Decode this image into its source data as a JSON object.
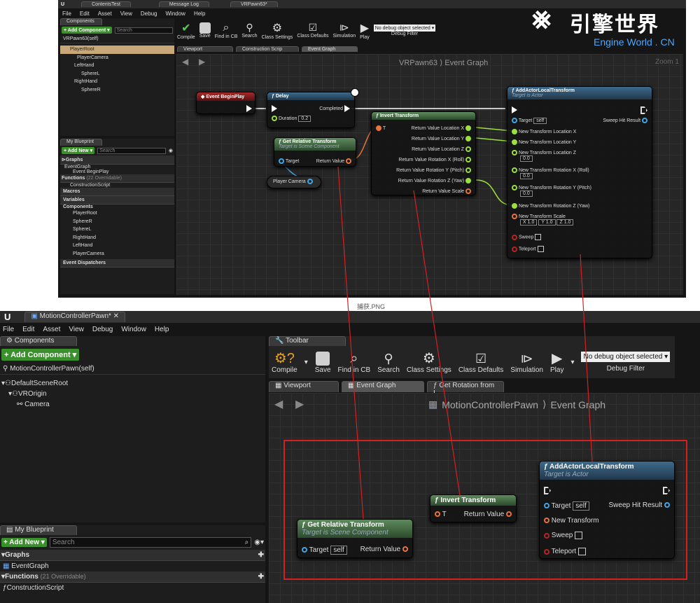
{
  "top": {
    "tabs": [
      "ContentsTest",
      "Message Log",
      "VRPawn63*"
    ],
    "menu": [
      "File",
      "Edit",
      "Asset",
      "View",
      "Debug",
      "Window",
      "Help"
    ],
    "components_tab": "Components",
    "add_component": "+ Add Component ▾",
    "search_placeholder": "Search",
    "self_label": "VRPawn63(self)",
    "tree": [
      "PlayerRoot",
      "PlayerCamera",
      "LeftHand",
      "SphereL",
      "RightHand",
      "SphereR"
    ],
    "my_blueprint_tab": "My Blueprint",
    "add_new": "+ Add New ▾",
    "graphs_header": "Graphs",
    "graph_items": [
      "EventGraph",
      "Event BeginPlay"
    ],
    "functions_header": "Functions",
    "functions_count": "(22 Overridable)",
    "function_items": [
      "ConstructionScript"
    ],
    "macros_header": "Macros",
    "variables_header": "Variables",
    "components_header": "Components",
    "variable_items": [
      "PlayerRoot",
      "SphereR",
      "SphereL",
      "RightHand",
      "LeftHand",
      "PlayerCamera"
    ],
    "dispatchers_header": "Event Dispatchers",
    "toolbar": [
      "Compile",
      "Save",
      "Find in CB",
      "Search",
      "Class Settings",
      "Class Defaults",
      "Simulation",
      "Play"
    ],
    "debug_select": "No debug object selected ▾",
    "debug_filter": "Debug Filter",
    "graph_tabs": [
      "Viewport",
      "Construction Scrip",
      "Event Graph"
    ],
    "breadcrumb": "VRPawn63 ⟩ Event Graph",
    "zoom": "Zoom 1",
    "nodes": {
      "begin": {
        "title": "Event BeginPlay"
      },
      "delay": {
        "title": "Delay",
        "completed": "Completed",
        "duration": "Duration",
        "duration_val": "0.2"
      },
      "grt": {
        "title": "Get Relative Transform",
        "subtitle": "Target is Scene Component",
        "target": "Target",
        "ret": "Return Value"
      },
      "player_camera": "Player Camera",
      "inv": {
        "title": "Invert Transform",
        "t": "T",
        "outs": [
          "Return Value Location X",
          "Return Value Location Y",
          "Return Value Location Z",
          "Return Value Rotation X (Roll)",
          "Return Value Rotation Y (Pitch)",
          "Return Value Rotation Z (Yaw)",
          "Return Value Scale"
        ]
      },
      "aalt": {
        "title": "AddActorLocalTransform",
        "subtitle": "Target is Actor",
        "target": "Target",
        "self": "self",
        "sweep_hit": "Sweep Hit Result",
        "pins": [
          "New Transform Location X",
          "New Transform Location Y",
          "New Transform Location Z",
          "New Transform Rotation X (Roll)",
          "New Transform Rotation Y (Pitch)",
          "New Transform Rotation Z (Yaw)",
          "New Transform Scale"
        ],
        "zero": "0.0",
        "scale_x": "X 1.0",
        "scale_y": "Y 1.0",
        "scale_z": "Z 1.0",
        "sweep": "Sweep",
        "teleport": "Teleport"
      }
    }
  },
  "caption": "捕获.PNG",
  "watermark": {
    "cn": "引擎世界",
    "en": "Engine World . CN"
  },
  "bottom": {
    "title_tab": "MotionControllerPawn*",
    "menu": [
      "File",
      "Edit",
      "Asset",
      "View",
      "Debug",
      "Window",
      "Help"
    ],
    "components_tab": "Components",
    "add_component": "+ Add Component ▾",
    "self_label": "MotionControllerPawn(self)",
    "tree": [
      "DefaultSceneRoot",
      "VROrigin",
      "Camera"
    ],
    "toolbar_tab": "Toolbar",
    "toolbar": [
      "Compile",
      "Save",
      "Find in CB",
      "Search",
      "Class Settings",
      "Class Defaults",
      "Simulation",
      "Play"
    ],
    "debug_select": "No debug object selected ▾",
    "debug_filter": "Debug Filter",
    "graph_tabs": [
      "Viewport",
      "Event Graph",
      "Get Rotation from I"
    ],
    "breadcrumb_a": "MotionControllerPawn",
    "breadcrumb_b": "Event Graph",
    "my_blueprint_tab": "My Blueprint",
    "add_new": "+ Add New ▾",
    "search_placeholder": "Search",
    "graphs_header": "Graphs",
    "graph_item": "EventGraph",
    "functions_header": "Functions",
    "functions_count": "(21 Overridable)",
    "function_item": "ConstructionScript",
    "nodes": {
      "grt": {
        "title": "Get Relative Transform",
        "subtitle": "Target is Scene Component",
        "target": "Target",
        "self": "self",
        "ret": "Return Value"
      },
      "inv": {
        "title": "Invert Transform",
        "t": "T",
        "ret": "Return Value"
      },
      "aalt": {
        "title": "AddActorLocalTransform",
        "subtitle": "Target is Actor",
        "target": "Target",
        "self": "self",
        "sweep_hit": "Sweep Hit Result",
        "new_transform": "New Transform",
        "sweep": "Sweep",
        "teleport": "Teleport"
      }
    }
  },
  "colors": {
    "highlight": "#d62020",
    "exec": "#ffffff",
    "transform": "#e8743b",
    "object": "#3fa6e6",
    "float": "#9be03c"
  }
}
